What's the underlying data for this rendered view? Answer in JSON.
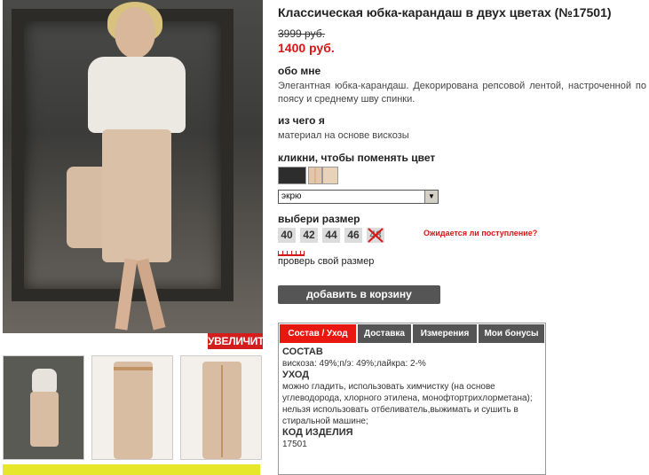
{
  "product": {
    "title": "Классическая юбка-карандаш в двух цветах (№17501)",
    "old_price": "3999 руб.",
    "new_price": "1400 руб.",
    "zoom_label": "УВЕЛИЧИТЬ"
  },
  "about": {
    "heading": "обо мне",
    "text": "Элегантная юбка-карандаш. Декорирована репсовой лентой, настроченной по поясу и среднему шву спинки."
  },
  "material": {
    "heading": "из чего я",
    "text": "материал на основе вискозы"
  },
  "color": {
    "heading": "кликни, чтобы поменять цвет",
    "selected": "экрю",
    "arrow_icon": "chevron-down-icon"
  },
  "size": {
    "heading": "выбери размер",
    "options": [
      "40",
      "42",
      "44",
      "46",
      "48"
    ],
    "waiting_link": "Ожидается ли поступление?",
    "check_link": "проверь свой размер"
  },
  "cart": {
    "button_label": "добавить в корзину"
  },
  "tabs": {
    "items": [
      "Состав / Уход",
      "Доставка",
      "Измерения",
      "Мои бонусы"
    ],
    "active": "Состав / Уход"
  },
  "composition": {
    "composition_heading": "СОСТАВ",
    "composition_text": "вискоза: 49%;п/э: 49%;лайкра: 2-%",
    "care_heading": "УХОД",
    "care_text": "можно гладить, использовать химчистку (на основе углеводорода, хлорного этилена, монофтортрихлорметана); нельзя использовать отбеливатель,выжимать и сушить в стиральной машине;",
    "code_heading": "КОД ИЗДЕЛИЯ",
    "code_value": "17501"
  },
  "colors": {
    "price_red": "#d81616",
    "tab_active": "#e8170f",
    "button_gray": "#555555"
  }
}
